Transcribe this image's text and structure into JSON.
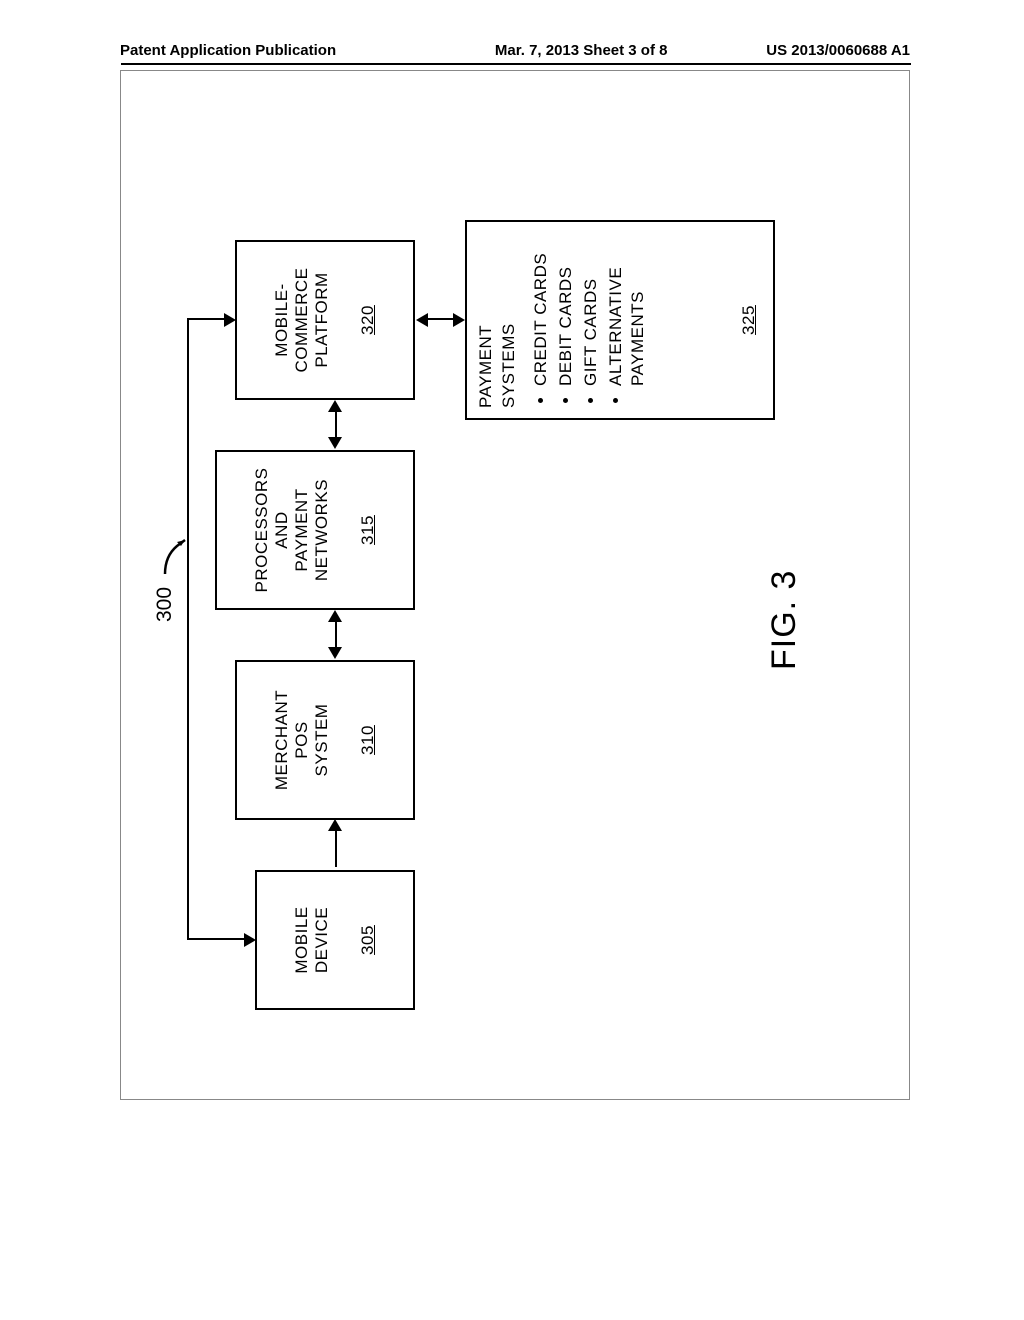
{
  "header": {
    "left": "Patent Application Publication",
    "center": "Mar. 7, 2013  Sheet 3 of 8",
    "right": "US 2013/0060688 A1"
  },
  "figure_ref": "300",
  "figure_caption": "FIG. 3",
  "boxes": {
    "b305": {
      "lines": [
        "MOBILE",
        "DEVICE"
      ],
      "ref": "305"
    },
    "b310": {
      "lines": [
        "MERCHANT",
        "POS",
        "SYSTEM"
      ],
      "ref": "310"
    },
    "b315": {
      "lines": [
        "PROCESSORS",
        "AND",
        "PAYMENT",
        "NETWORKS"
      ],
      "ref": "315"
    },
    "b320": {
      "lines": [
        "MOBILE-",
        "COMMERCE",
        "PLATFORM"
      ],
      "ref": "320"
    },
    "b325": {
      "title_lines": [
        "PAYMENT",
        "SYSTEMS"
      ],
      "items": [
        "CREDIT CARDS",
        "DEBIT CARDS",
        "GIFT CARDS",
        "ALTERNATIVE PAYMENTS"
      ],
      "ref": "325"
    }
  }
}
